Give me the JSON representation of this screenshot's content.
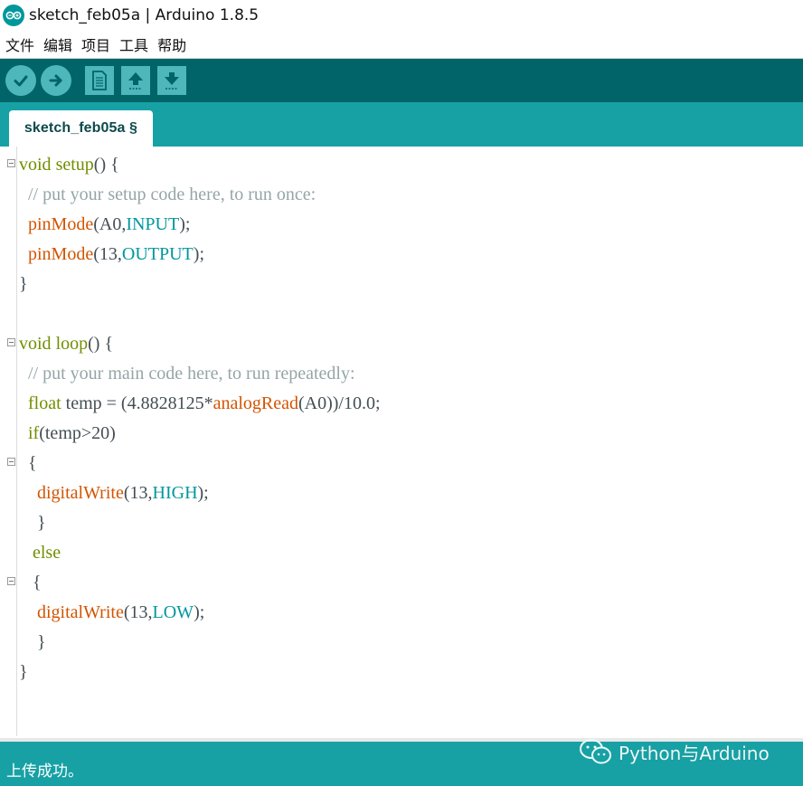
{
  "window": {
    "title": "sketch_feb05a | Arduino 1.8.5",
    "logo_icon": "arduino-logo-icon"
  },
  "menu": {
    "items": [
      "文件",
      "编辑",
      "项目",
      "工具",
      "帮助"
    ]
  },
  "toolbar": {
    "buttons": [
      {
        "icon": "check-icon",
        "action": "verify"
      },
      {
        "icon": "arrow-right-icon",
        "action": "upload"
      },
      {
        "icon": "new-file-icon",
        "action": "new"
      },
      {
        "icon": "arrow-up-icon",
        "action": "open"
      },
      {
        "icon": "arrow-down-icon",
        "action": "save"
      }
    ]
  },
  "tabs": [
    {
      "label": "sketch_feb05a §"
    }
  ],
  "editor": {
    "lines": [
      "void setup() {",
      "  // put your setup code here, to run once:",
      "  pinMode(A0,INPUT);",
      "  pinMode(13,OUTPUT);",
      "}",
      "",
      "void loop() {",
      "  // put your main code here, to run repeatedly:",
      "  float temp = (4.8828125*analogRead(A0))/10.0;",
      "  if(temp>20)",
      "  {",
      "    digitalWrite(13,HIGH);",
      "    }",
      "   else",
      "   {",
      "    digitalWrite(13,LOW);",
      "    }",
      "}"
    ]
  },
  "status": {
    "message": "上传成功。"
  },
  "watermark": {
    "text": "Python与Arduino"
  },
  "colors": {
    "toolbar_bg": "#006468",
    "tab_bar_bg": "#17a1a5",
    "button_bg": "#4db7bb",
    "keyword": "#728e00",
    "function": "#d35400",
    "constant": "#00979d",
    "comment": "#95a5a6"
  }
}
